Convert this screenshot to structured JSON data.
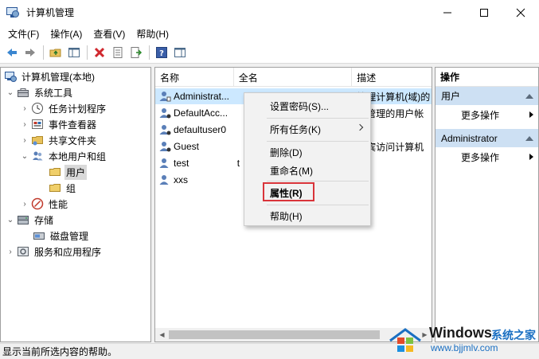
{
  "window": {
    "title": "计算机管理"
  },
  "menubar": [
    "文件(F)",
    "操作(A)",
    "查看(V)",
    "帮助(H)"
  ],
  "tree": {
    "root": "计算机管理(本地)",
    "system_tools": "系统工具",
    "task_scheduler": "任务计划程序",
    "event_viewer": "事件查看器",
    "shared_folders": "共享文件夹",
    "local_users_groups": "本地用户和组",
    "users": "用户",
    "groups": "组",
    "performance": "性能",
    "storage": "存储",
    "disk_management": "磁盘管理",
    "services_apps": "服务和应用程序"
  },
  "list": {
    "headers": [
      "名称",
      "全名",
      "描述"
    ],
    "rows": [
      {
        "name": "Administrat...",
        "fullname": "",
        "desc": "管理计算机(域)的"
      },
      {
        "name": "DefaultAcc...",
        "fullname": "",
        "desc": "统管理的用户帐"
      },
      {
        "name": "defaultuser0",
        "fullname": "",
        "desc": ""
      },
      {
        "name": "Guest",
        "fullname": "",
        "desc": "来宾访问计算机"
      },
      {
        "name": "test",
        "fullname": "t",
        "desc": ""
      },
      {
        "name": "xxs",
        "fullname": "",
        "desc": ""
      }
    ]
  },
  "actions": {
    "title": "操作",
    "section1": "用户",
    "more1": "更多操作",
    "section2": "Administrator",
    "more2": "更多操作"
  },
  "context_menu": {
    "set_password": "设置密码(S)...",
    "all_tasks": "所有任务(K)",
    "delete": "删除(D)",
    "rename": "重命名(M)",
    "properties": "属性(R)",
    "help": "帮助(H)"
  },
  "status": "显示当前所选内容的帮助。",
  "watermark": {
    "brand": "Windows",
    "cn": "系统之家",
    "url": "www.bjjmlv.com"
  },
  "colors": {
    "selection": "#cce8ff",
    "highlight_box": "#d9343a",
    "action_section": "#cde0f3"
  }
}
